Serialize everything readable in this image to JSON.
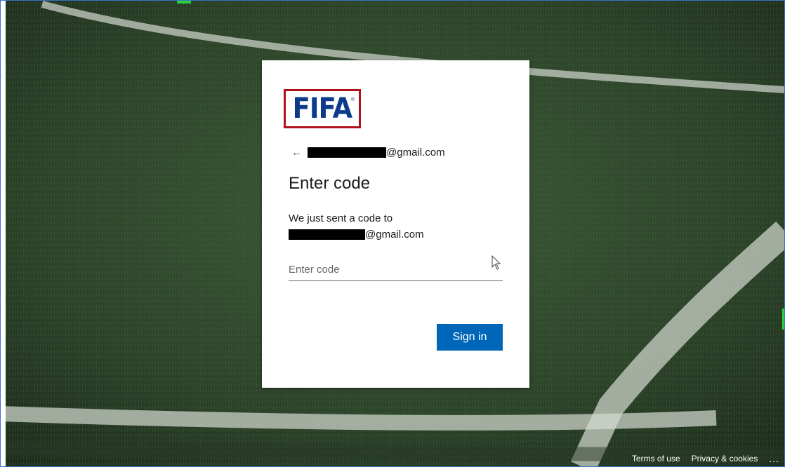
{
  "logo": {
    "text": "FIFA",
    "mark": "®",
    "frame_color": "#b0121b",
    "text_color": "#0d3b8c"
  },
  "identity": {
    "back_icon": "←",
    "email_suffix": "@gmail.com"
  },
  "title": "Enter code",
  "description": {
    "line1": "We just sent a code to",
    "email_suffix": "@gmail.com"
  },
  "code_field": {
    "placeholder": "Enter code",
    "value": ""
  },
  "sign_in": {
    "label": "Sign in",
    "color": "#0067b8"
  },
  "footer": {
    "terms": "Terms of use",
    "privacy": "Privacy & cookies",
    "more": "..."
  }
}
